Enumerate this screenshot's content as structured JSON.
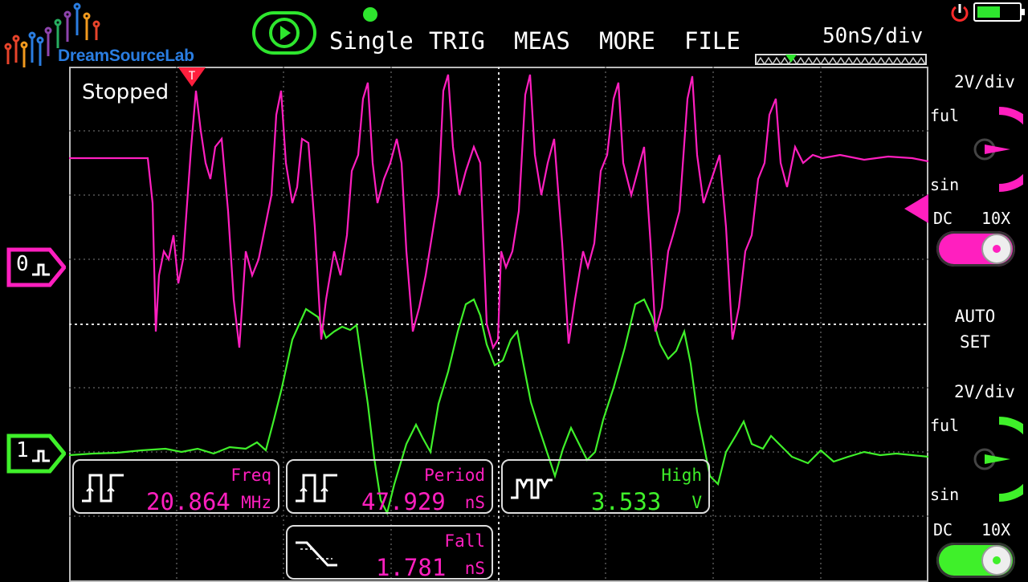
{
  "brand": {
    "name": "DreamSourceLab"
  },
  "toolbar": {
    "run_state": "play",
    "single_label": "Single",
    "trig_label": "TRIG",
    "meas_label": "MEAS",
    "more_label": "MORE",
    "file_label": "FILE",
    "timebase": "50nS/div"
  },
  "status": {
    "text": "Stopped",
    "battery_level": 0.55
  },
  "channels": [
    {
      "id": "0",
      "color": "#ff1fbf",
      "vdiv": "2V/div",
      "top_label": "ful",
      "bottom_label": "sin",
      "coupling": "DC",
      "probe": "10X"
    },
    {
      "id": "1",
      "color": "#3ff02a",
      "vdiv": "2V/div",
      "top_label": "ful",
      "bottom_label": "sin",
      "coupling": "DC",
      "probe": "10X"
    }
  ],
  "auto_set": {
    "line1": "AUTO",
    "line2": "SET"
  },
  "measurements": [
    {
      "name": "Freq",
      "value": "20.864",
      "unit": "MHz",
      "color": "#ff1fbf",
      "icon": "pulse-icon"
    },
    {
      "name": "Period",
      "value": "47.929",
      "unit": "nS",
      "color": "#ff1fbf",
      "icon": "pulse-icon"
    },
    {
      "name": "High",
      "value": "3.533",
      "unit": "V",
      "color": "#3ff02a",
      "icon": "waveform-icon"
    },
    {
      "name": "Fall",
      "value": "1.781",
      "unit": "nS",
      "color": "#ff1fbf",
      "icon": "falling-edge-icon"
    }
  ]
}
